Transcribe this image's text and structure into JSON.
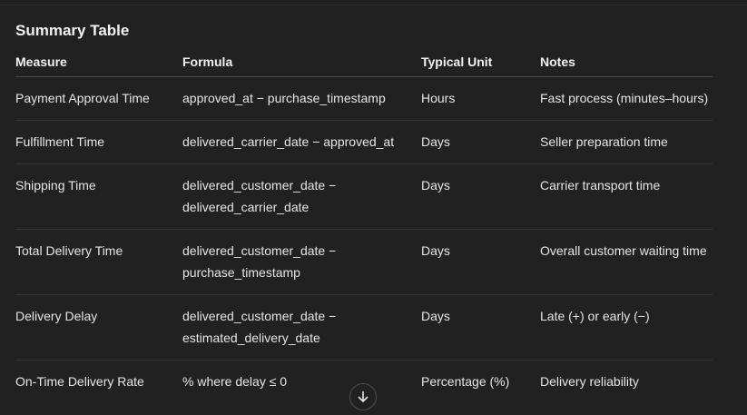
{
  "heading": "Summary Table",
  "columns": [
    "Measure",
    "Formula",
    "Typical Unit",
    "Notes"
  ],
  "rows": [
    {
      "measure": "Payment Approval Time",
      "formula": "approved_at − purchase_timestamp",
      "unit": "Hours",
      "notes": "Fast process (minutes–hours)"
    },
    {
      "measure": "Fulfillment Time",
      "formula": "delivered_carrier_date − approved_at",
      "unit": "Days",
      "notes": "Seller preparation time"
    },
    {
      "measure": "Shipping Time",
      "formula": "delivered_customer_date − delivered_carrier_date",
      "unit": "Days",
      "notes": "Carrier transport time"
    },
    {
      "measure": "Total Delivery Time",
      "formula": "delivered_customer_date − purchase_timestamp",
      "unit": "Days",
      "notes": "Overall customer waiting time"
    },
    {
      "measure": "Delivery Delay",
      "formula": "delivered_customer_date − estimated_delivery_date",
      "unit": "Days",
      "notes": "Late (+) or early (−)"
    },
    {
      "measure": "On-Time Delivery Rate",
      "formula": "% where delay ≤ 0",
      "unit": "Percentage (%)",
      "notes": "Delivery reliability"
    }
  ],
  "scroll_button": {
    "icon": "arrow-down-icon"
  },
  "colors": {
    "background": "#212121",
    "text": "#ececec",
    "row_divider": "#343434"
  }
}
